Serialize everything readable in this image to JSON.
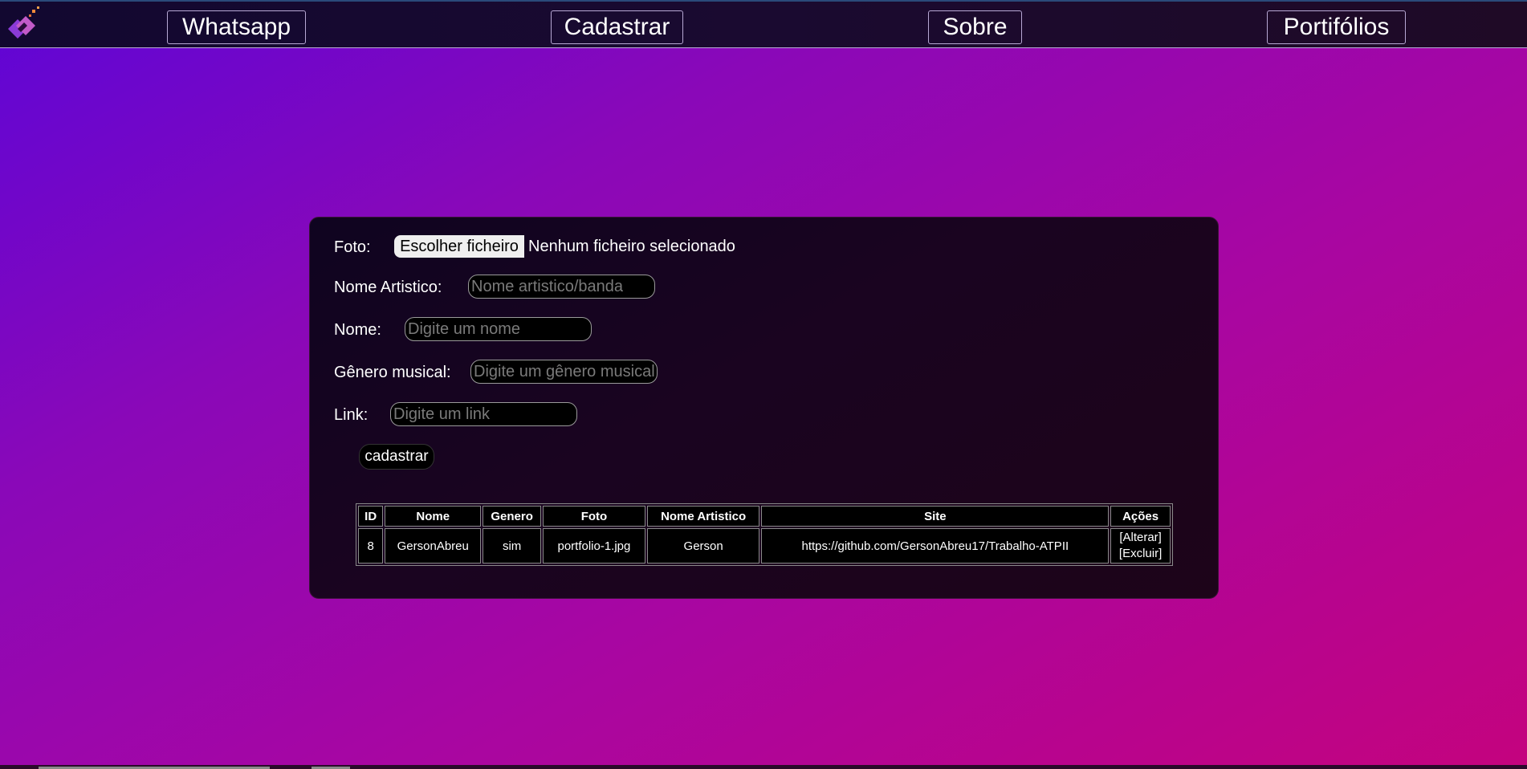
{
  "nav": {
    "whatsapp": "Whatsapp",
    "cadastrar": "Cadastrar",
    "sobre": "Sobre",
    "portfolios": "Portifólios"
  },
  "form": {
    "foto_label": "Foto:",
    "file_button": "Escolher ficheiro",
    "file_status": "Nenhum ficheiro selecionado",
    "nome_artistico_label": "Nome Artistico:",
    "nome_artistico_placeholder": "Nome artistico/banda",
    "nome_label": "Nome:",
    "nome_placeholder": "Digite um nome",
    "genero_label": "Gênero musical:",
    "genero_placeholder": "Digite um gênero musical",
    "link_label": "Link:",
    "link_placeholder": "Digite um link",
    "submit_label": "cadastrar"
  },
  "table": {
    "headers": [
      "ID",
      "Nome",
      "Genero",
      "Foto",
      "Nome Artistico",
      "Site",
      "Ações"
    ],
    "rows": [
      {
        "id": "8",
        "nome": "GersonAbreu",
        "genero": "sim",
        "foto": "portfolio-1.jpg",
        "nome_artistico": "Gerson",
        "site": "https://github.com/GersonAbreu17/Trabalho-ATPII",
        "alterar": "[Alterar]",
        "excluir": "[Excluir]"
      }
    ]
  },
  "colors": {
    "gradient_start": "#5e05d6",
    "gradient_end": "#c4037e",
    "card_background": "#12041c",
    "topbar_background": "#150a2e"
  },
  "icons": {
    "logo": "logo-icon"
  }
}
